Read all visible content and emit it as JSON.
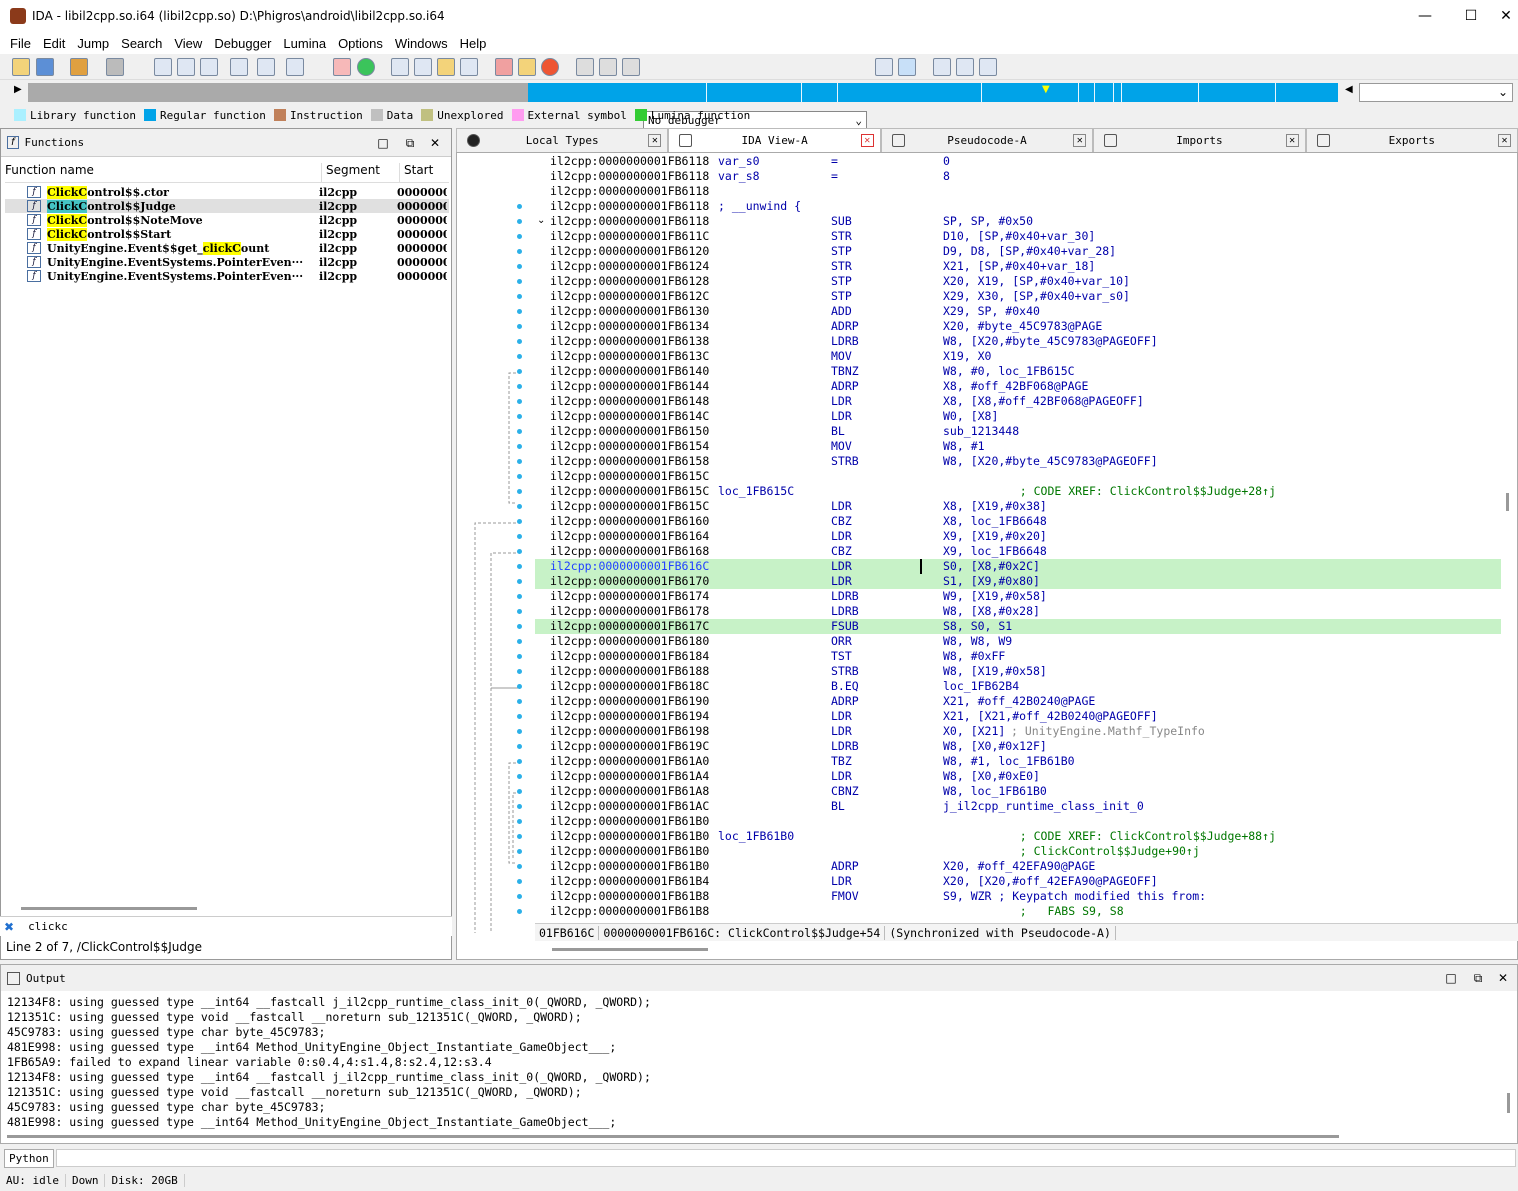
{
  "window": {
    "title": "IDA - libil2cpp.so.i64 (libil2cpp.so) D:\\Phigros\\android\\libil2cpp.so.i64",
    "minimize": "—",
    "maximize": "☐",
    "close": "✕"
  },
  "menu": [
    "File",
    "Edit",
    "Jump",
    "Search",
    "View",
    "Debugger",
    "Lumina",
    "Options",
    "Windows",
    "Help"
  ],
  "toolbar": {
    "debugger_select": "No debugger"
  },
  "legend": [
    {
      "label": "Library function",
      "color": "#aaf0ff"
    },
    {
      "label": "Regular function",
      "color": "#00a3e8"
    },
    {
      "label": "Instruction",
      "color": "#c0805a"
    },
    {
      "label": "Data",
      "color": "#c0c0c0"
    },
    {
      "label": "Unexplored",
      "color": "#c0c080"
    },
    {
      "label": "External symbol",
      "color": "#ff9cf0"
    },
    {
      "label": "Lumina function",
      "color": "#33cc33"
    }
  ],
  "functions_panel": {
    "title": "Functions",
    "columns": [
      "Function name",
      "Segment",
      "Start"
    ],
    "rows": [
      {
        "pre": "",
        "hl": "ClickC",
        "post": "ontrol$$.ctor",
        "seg": "il2cpp",
        "start": "0000000"
      },
      {
        "pre": "",
        "hl": "ClickC",
        "post": "ontrol$$Judge",
        "seg": "il2cpp",
        "start": "0000000"
      },
      {
        "pre": "",
        "hl": "ClickC",
        "post": "ontrol$$NoteMove",
        "seg": "il2cpp",
        "start": "0000000"
      },
      {
        "pre": "",
        "hl": "ClickC",
        "post": "ontrol$$Start",
        "seg": "il2cpp",
        "start": "0000000"
      },
      {
        "pre": "UnityEngine.Event$$get_",
        "hl": "clickC",
        "post": "ount",
        "seg": "il2cpp",
        "start": "0000000"
      },
      {
        "pre": "UnityEngine.EventSystems.PointerEven···",
        "hl": "",
        "post": "",
        "seg": "il2cpp",
        "start": "0000000"
      },
      {
        "pre": "UnityEngine.EventSystems.PointerEven···",
        "hl": "",
        "post": "",
        "seg": "il2cpp",
        "start": "0000000"
      }
    ],
    "filter": "clickc",
    "status": "Line 2 of 7, /ClickControl$$Judge"
  },
  "tabs": [
    {
      "label": "Local Types"
    },
    {
      "label": "IDA View-A"
    },
    {
      "label": "Pseudocode-A"
    },
    {
      "label": "Imports"
    },
    {
      "label": "Exports"
    }
  ],
  "code": [
    {
      "ad": "il2cpp:0000000001FB6118",
      "lb": "var_s0",
      "mn": "=",
      "op": "0",
      "cm": ""
    },
    {
      "ad": "il2cpp:0000000001FB6118",
      "lb": "var_s8",
      "mn": "=",
      "op": "8",
      "cm": ""
    },
    {
      "ad": "il2cpp:0000000001FB6118",
      "lb": "",
      "mn": "",
      "op": "",
      "cm": ""
    },
    {
      "ad": "il2cpp:0000000001FB6118",
      "lb": "; __unwind {",
      "mn": "",
      "op": "",
      "cm": ""
    },
    {
      "ad": "il2cpp:0000000001FB6118",
      "lb": "",
      "mn": "SUB",
      "op": "SP, SP, #0x50",
      "cm": ""
    },
    {
      "ad": "il2cpp:0000000001FB611C",
      "lb": "",
      "mn": "STR",
      "op": "D10, [SP,#0x40+var_30]",
      "cm": ""
    },
    {
      "ad": "il2cpp:0000000001FB6120",
      "lb": "",
      "mn": "STP",
      "op": "D9, D8, [SP,#0x40+var_28]",
      "cm": ""
    },
    {
      "ad": "il2cpp:0000000001FB6124",
      "lb": "",
      "mn": "STR",
      "op": "X21, [SP,#0x40+var_18]",
      "cm": ""
    },
    {
      "ad": "il2cpp:0000000001FB6128",
      "lb": "",
      "mn": "STP",
      "op": "X20, X19, [SP,#0x40+var_10]",
      "cm": ""
    },
    {
      "ad": "il2cpp:0000000001FB612C",
      "lb": "",
      "mn": "STP",
      "op": "X29, X30, [SP,#0x40+var_s0]",
      "cm": ""
    },
    {
      "ad": "il2cpp:0000000001FB6130",
      "lb": "",
      "mn": "ADD",
      "op": "X29, SP, #0x40",
      "cm": ""
    },
    {
      "ad": "il2cpp:0000000001FB6134",
      "lb": "",
      "mn": "ADRP",
      "op": "X20, #byte_45C9783@PAGE",
      "cm": ""
    },
    {
      "ad": "il2cpp:0000000001FB6138",
      "lb": "",
      "mn": "LDRB",
      "op": "W8, [X20,#byte_45C9783@PAGEOFF]",
      "cm": ""
    },
    {
      "ad": "il2cpp:0000000001FB613C",
      "lb": "",
      "mn": "MOV",
      "op": "X19, X0",
      "cm": ""
    },
    {
      "ad": "il2cpp:0000000001FB6140",
      "lb": "",
      "mn": "TBNZ",
      "op": "W8, #0, loc_1FB615C",
      "cm": ""
    },
    {
      "ad": "il2cpp:0000000001FB6144",
      "lb": "",
      "mn": "ADRP",
      "op": "X8, #off_42BF068@PAGE",
      "cm": ""
    },
    {
      "ad": "il2cpp:0000000001FB6148",
      "lb": "",
      "mn": "LDR",
      "op": "X8, [X8,#off_42BF068@PAGEOFF]",
      "cm": ""
    },
    {
      "ad": "il2cpp:0000000001FB614C",
      "lb": "",
      "mn": "LDR",
      "op": "W0, [X8]",
      "cm": ""
    },
    {
      "ad": "il2cpp:0000000001FB6150",
      "lb": "",
      "mn": "BL",
      "op": "sub_1213448",
      "cm": ""
    },
    {
      "ad": "il2cpp:0000000001FB6154",
      "lb": "",
      "mn": "MOV",
      "op": "W8, #1",
      "cm": ""
    },
    {
      "ad": "il2cpp:0000000001FB6158",
      "lb": "",
      "mn": "STRB",
      "op": "W8, [X20,#byte_45C9783@PAGEOFF]",
      "cm": ""
    },
    {
      "ad": "il2cpp:0000000001FB615C",
      "lb": "",
      "mn": "",
      "op": "",
      "cm": ""
    },
    {
      "ad": "il2cpp:0000000001FB615C",
      "lb": "loc_1FB615C",
      "mn": "",
      "op": "",
      "cm": "   ; CODE XREF: ClickControl$$Judge+28↑j"
    },
    {
      "ad": "il2cpp:0000000001FB615C",
      "lb": "",
      "mn": "LDR",
      "op": "X8, [X19,#0x38]",
      "cm": ""
    },
    {
      "ad": "il2cpp:0000000001FB6160",
      "lb": "",
      "mn": "CBZ",
      "op": "X8, loc_1FB6648",
      "cm": ""
    },
    {
      "ad": "il2cpp:0000000001FB6164",
      "lb": "",
      "mn": "LDR",
      "op": "X9, [X19,#0x20]",
      "cm": ""
    },
    {
      "ad": "il2cpp:0000000001FB6168",
      "lb": "",
      "mn": "CBZ",
      "op": "X9, loc_1FB6648",
      "cm": ""
    },
    {
      "ad": "il2cpp:0000000001FB616C",
      "lb": "",
      "mn": "LDR",
      "op": "S0, [X8,#0x2C]",
      "cm": "",
      "sel": true,
      "cur": true
    },
    {
      "ad": "il2cpp:0000000001FB6170",
      "lb": "",
      "mn": "LDR",
      "op": "S1, [X9,#0x80]",
      "cm": "",
      "sel": true
    },
    {
      "ad": "il2cpp:0000000001FB6174",
      "lb": "",
      "mn": "LDRB",
      "op": "W9, [X19,#0x58]",
      "cm": ""
    },
    {
      "ad": "il2cpp:0000000001FB6178",
      "lb": "",
      "mn": "LDRB",
      "op": "W8, [X8,#0x28]",
      "cm": ""
    },
    {
      "ad": "il2cpp:0000000001FB617C",
      "lb": "",
      "mn": "FSUB",
      "op": "S8, S0, S1",
      "cm": "",
      "sel": true
    },
    {
      "ad": "il2cpp:0000000001FB6180",
      "lb": "",
      "mn": "ORR",
      "op": "W8, W8, W9",
      "cm": ""
    },
    {
      "ad": "il2cpp:0000000001FB6184",
      "lb": "",
      "mn": "TST",
      "op": "W8, #0xFF",
      "cm": ""
    },
    {
      "ad": "il2cpp:0000000001FB6188",
      "lb": "",
      "mn": "STRB",
      "op": "W8, [X19,#0x58]",
      "cm": ""
    },
    {
      "ad": "il2cpp:0000000001FB618C",
      "lb": "",
      "mn": "B.EQ",
      "op": "loc_1FB62B4",
      "cm": ""
    },
    {
      "ad": "il2cpp:0000000001FB6190",
      "lb": "",
      "mn": "ADRP",
      "op": "X21, #off_42B0240@PAGE",
      "cm": ""
    },
    {
      "ad": "il2cpp:0000000001FB6194",
      "lb": "",
      "mn": "LDR",
      "op": "X21, [X21,#off_42B0240@PAGEOFF]",
      "cm": ""
    },
    {
      "ad": "il2cpp:0000000001FB6198",
      "lb": "",
      "mn": "LDR",
      "op": "X0, [X21]",
      "cm": "",
      "cm2": "; UnityEngine.Mathf_TypeInfo"
    },
    {
      "ad": "il2cpp:0000000001FB619C",
      "lb": "",
      "mn": "LDRB",
      "op": "W8, [X0,#0x12F]",
      "cm": ""
    },
    {
      "ad": "il2cpp:0000000001FB61A0",
      "lb": "",
      "mn": "TBZ",
      "op": "W8, #1, loc_1FB61B0",
      "cm": ""
    },
    {
      "ad": "il2cpp:0000000001FB61A4",
      "lb": "",
      "mn": "LDR",
      "op": "W8, [X0,#0xE0]",
      "cm": ""
    },
    {
      "ad": "il2cpp:0000000001FB61A8",
      "lb": "",
      "mn": "CBNZ",
      "op": "W8, loc_1FB61B0",
      "cm": ""
    },
    {
      "ad": "il2cpp:0000000001FB61AC",
      "lb": "",
      "mn": "BL",
      "op": "j_il2cpp_runtime_class_init_0",
      "cm": ""
    },
    {
      "ad": "il2cpp:0000000001FB61B0",
      "lb": "",
      "mn": "",
      "op": "",
      "cm": ""
    },
    {
      "ad": "il2cpp:0000000001FB61B0",
      "lb": "loc_1FB61B0",
      "mn": "",
      "op": "",
      "cm": "   ; CODE XREF: ClickControl$$Judge+88↑j"
    },
    {
      "ad": "il2cpp:0000000001FB61B0",
      "lb": "",
      "mn": "",
      "op": "",
      "cm": "   ; ClickControl$$Judge+90↑j"
    },
    {
      "ad": "il2cpp:0000000001FB61B0",
      "lb": "",
      "mn": "ADRP",
      "op": "X20, #off_42EFA90@PAGE",
      "cm": ""
    },
    {
      "ad": "il2cpp:0000000001FB61B4",
      "lb": "",
      "mn": "LDR",
      "op": "X20, [X20,#off_42EFA90@PAGEOFF]",
      "cm": ""
    },
    {
      "ad": "il2cpp:0000000001FB61B8",
      "lb": "",
      "mn": "FMOV",
      "op": "S9, WZR ; Keypatch modified this from:",
      "cm": ""
    },
    {
      "ad": "il2cpp:0000000001FB61B8",
      "lb": "",
      "mn": "",
      "op": "",
      "cm": "   ;   FABS S9, S8"
    }
  ],
  "code_status": {
    "offset": "01FB616C",
    "location": "0000000001FB616C: ClickControl$$Judge+54",
    "sync": "(Synchronized with Pseudocode-A)"
  },
  "output_panel": {
    "title": "Output",
    "lines": [
      "12134F8: using guessed type __int64 __fastcall j_il2cpp_runtime_class_init_0(_QWORD, _QWORD);",
      "121351C: using guessed type void __fastcall __noreturn sub_121351C(_QWORD, _QWORD);",
      "45C9783: using guessed type char byte_45C9783;",
      "481E998: using guessed type __int64 Method_UnityEngine_Object_Instantiate_GameObject___;",
      "1FB65A9: failed to expand linear variable 0:s0.4,4:s1.4,8:s2.4,12:s3.4",
      "12134F8: using guessed type __int64 __fastcall j_il2cpp_runtime_class_init_0(_QWORD, _QWORD);",
      "121351C: using guessed type void __fastcall __noreturn sub_121351C(_QWORD, _QWORD);",
      "45C9783: using guessed type char byte_45C9783;",
      "481E998: using guessed type __int64 Method_UnityEngine_Object_Instantiate_GameObject___;"
    ]
  },
  "python_button": "Python",
  "status": {
    "au": "AU:  idle",
    "dir": "Down",
    "disk": "Disk: 20GB"
  }
}
